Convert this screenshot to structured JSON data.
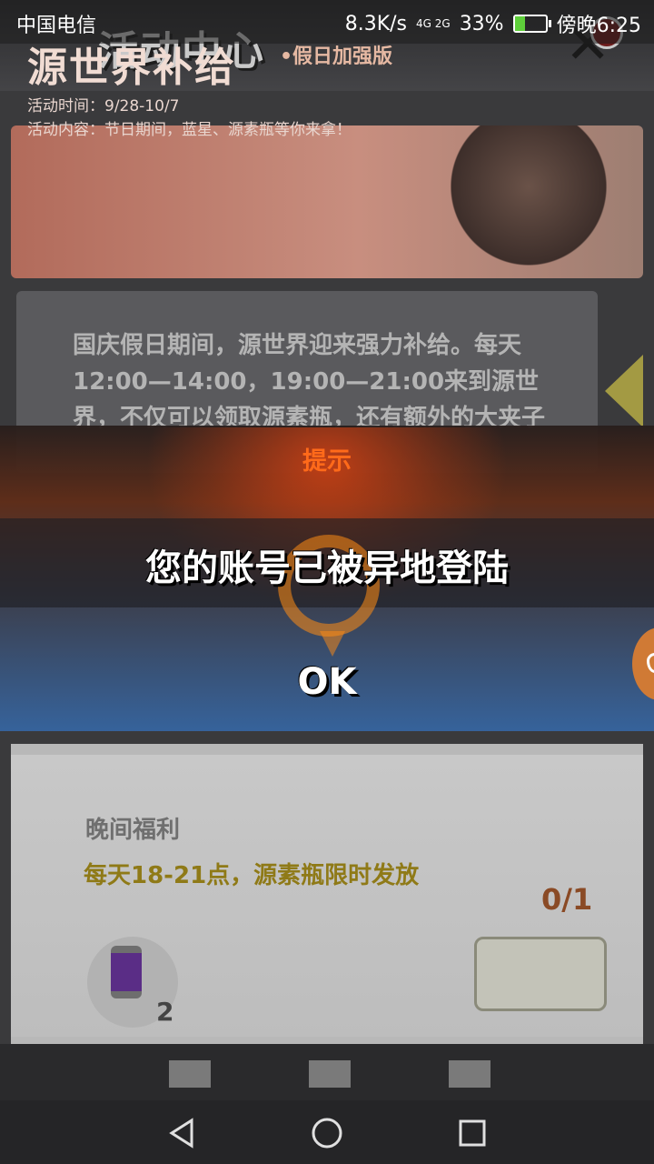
{
  "status_bar": {
    "carrier": "中国电信",
    "speed": "8.3K/s",
    "network": "4G 2G",
    "battery": "33%",
    "battery_level": 0.33,
    "time": "傍晚6:25"
  },
  "header": {
    "title": "活动中心",
    "close_icon": "close-x-icon"
  },
  "banner": {
    "title": "源世界补给",
    "subtitle": "•假日加强版",
    "time": "活动时间：9/28-10/7",
    "content": "活动内容：节日期间，蓝星、源素瓶等你来拿！"
  },
  "description": {
    "text": "国庆假日期间，源世界迎来强力补给。每天12:00—14:00，19:00—21:00来到源世界，不仅可以领取源素瓶，还有额外的大夹子"
  },
  "reward": {
    "title": "晚间福利",
    "desc": "每天18-21点，源素瓶限时发放",
    "progress": "0/1",
    "item_count": "2"
  },
  "dialog": {
    "title": "提示",
    "message": "您的账号已被异地登陆",
    "ok_label": "OK"
  },
  "colors": {
    "dialog_title": "#ff6a1a",
    "dialog_top": "#5f2d19",
    "dialog_bottom": "#3664a0"
  }
}
